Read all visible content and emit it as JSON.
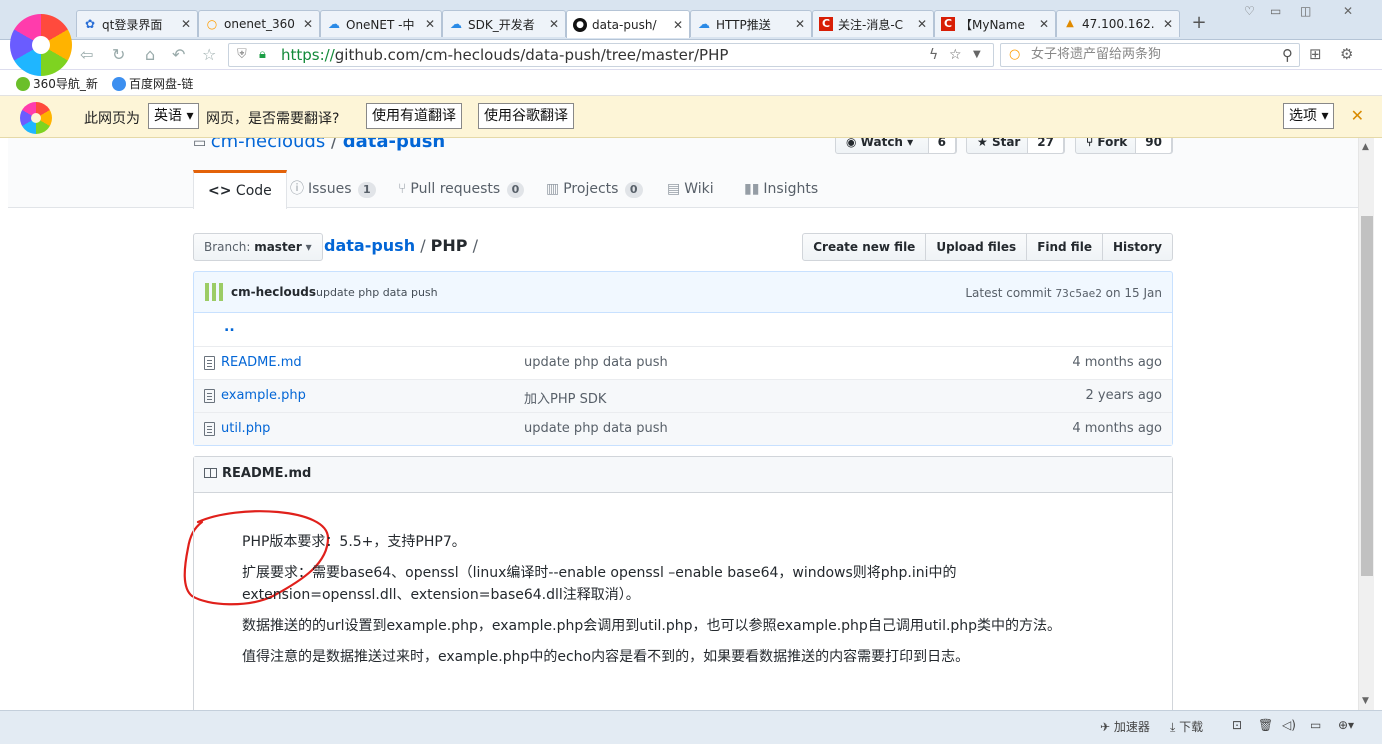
{
  "browser": {
    "tabs": [
      {
        "title": "qt登录界面",
        "icon": "paw-icon"
      },
      {
        "title": "onenet_360",
        "icon": "search-icon"
      },
      {
        "title": "OneNET -中",
        "icon": "cloud-icon"
      },
      {
        "title": "SDK_开发者",
        "icon": "cloud-icon"
      },
      {
        "title": "data-push/",
        "icon": "github-icon"
      },
      {
        "title": "HTTP推送",
        "icon": "cloud-icon"
      },
      {
        "title": "关注-消息-C",
        "icon": "csdn-icon"
      },
      {
        "title": "【MyName",
        "icon": "csdn-icon"
      },
      {
        "title": "47.100.162.",
        "icon": "pma-icon"
      }
    ],
    "url": {
      "scheme": "https://",
      "host": "github.com",
      "path": "/cm-heclouds/data-push/tree/master/PHP"
    },
    "search_placeholder": "女子将遗产留给两条狗",
    "bookmarks": [
      "360导航_新",
      "百度网盘-链"
    ],
    "translate": {
      "prefix": "此网页为",
      "lang": "英语",
      "suffix": "网页，是否需要翻译?",
      "youdao": "使用有道翻译",
      "google": "使用谷歌翻译",
      "options": "选项"
    },
    "status": {
      "accelerator": "加速器",
      "download": "下载"
    }
  },
  "repo": {
    "owner": "cm-heclouds",
    "name": "data-push",
    "watch": {
      "label": "Watch",
      "count": "6"
    },
    "star": {
      "label": "Star",
      "count": "27"
    },
    "fork": {
      "label": "Fork",
      "count": "90"
    },
    "tabs": {
      "code": "Code",
      "issues": "Issues",
      "issues_count": "1",
      "pulls": "Pull requests",
      "pulls_count": "0",
      "projects": "Projects",
      "projects_count": "0",
      "wiki": "Wiki",
      "insights": "Insights"
    }
  },
  "branch": {
    "prefix": "Branch:",
    "name": "master"
  },
  "breadcrumb": {
    "repo": "data-push",
    "dir": "PHP"
  },
  "file_buttons": {
    "create": "Create new file",
    "upload": "Upload files",
    "find": "Find file",
    "history": "History"
  },
  "commit": {
    "author": "cm-heclouds",
    "message": "update php data push",
    "latest_prefix": "Latest commit",
    "sha": "73c5ae2",
    "date": "on 15 Jan"
  },
  "files": [
    {
      "name": "README.md",
      "message": "update php data push",
      "age": "4 months ago"
    },
    {
      "name": "example.php",
      "message": "加入PHP SDK",
      "age": "2 years ago"
    },
    {
      "name": "util.php",
      "message": "update php data push",
      "age": "4 months ago"
    }
  ],
  "updir": "..",
  "readme": {
    "title": "README.md",
    "paragraphs": [
      "PHP版本要求：5.5+，支持PHP7。",
      "扩展要求：需要base64、openssl（linux编译时--enable openssl –enable base64，windows则将php.ini中的extension=openssl.dll、extension=base64.dll注释取消）。",
      "数据推送的的url设置到example.php，example.php会调用到util.php，也可以参照example.php自己调用util.php类中的方法。",
      "值得注意的是数据推送过来时，example.php中的echo内容是看不到的，如果要看数据推送的内容需要打印到日志。"
    ]
  }
}
